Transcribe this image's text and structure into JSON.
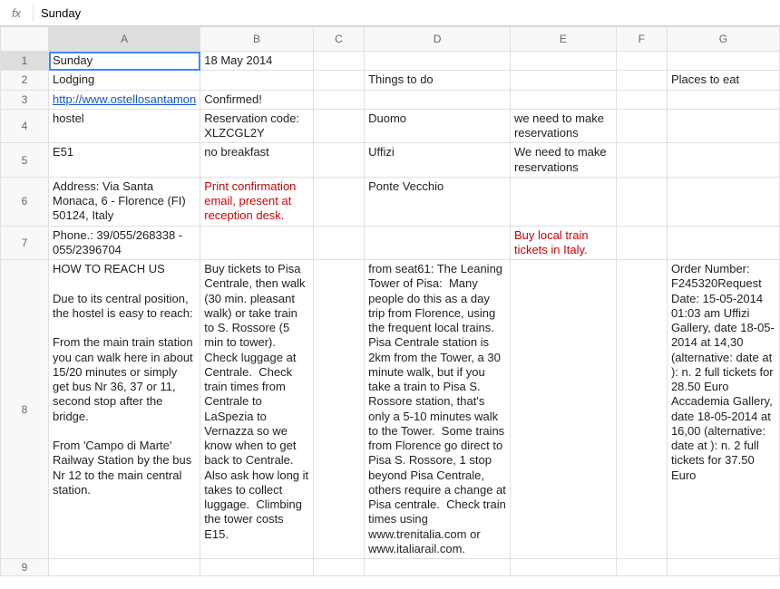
{
  "formula_bar": {
    "fx_label": "fx",
    "value": "Sunday"
  },
  "columns": [
    {
      "id": "A",
      "label": "A",
      "cls": "col-A"
    },
    {
      "id": "B",
      "label": "B",
      "cls": "col-B"
    },
    {
      "id": "C",
      "label": "C",
      "cls": "col-C"
    },
    {
      "id": "D",
      "label": "D",
      "cls": "col-D"
    },
    {
      "id": "E",
      "label": "E",
      "cls": "col-E"
    },
    {
      "id": "F",
      "label": "F",
      "cls": "col-F"
    },
    {
      "id": "G",
      "label": "G",
      "cls": "col-G"
    }
  ],
  "active_cell": "A1",
  "rows": [
    {
      "n": 1,
      "cells": {
        "A": {
          "text": "Sunday",
          "active": true
        },
        "B": {
          "text": "18 May 2014"
        }
      }
    },
    {
      "n": 2,
      "cells": {
        "A": {
          "text": "Lodging"
        },
        "D": {
          "text": "Things to do"
        },
        "G": {
          "text": "Places to eat"
        }
      }
    },
    {
      "n": 3,
      "cells": {
        "A": {
          "text": "http://www.ostellosantamon",
          "link": true
        },
        "B": {
          "text": "Confirmed!"
        }
      }
    },
    {
      "n": 4,
      "cells": {
        "A": {
          "text": "hostel"
        },
        "B": {
          "text": "Reservation code: XLZCGL2Y"
        },
        "D": {
          "text": "Duomo"
        },
        "E": {
          "text": "we need to make reservations"
        }
      }
    },
    {
      "n": 5,
      "cells": {
        "A": {
          "text": "E51"
        },
        "B": {
          "text": "no breakfast"
        },
        "D": {
          "text": "Uffizi"
        },
        "E": {
          "text": "We need to make reservations"
        }
      }
    },
    {
      "n": 6,
      "cells": {
        "A": {
          "text": "Address: Via Santa Monaca, 6 - Florence (FI) 50124, Italy"
        },
        "B": {
          "text": "Print confirmation email, present at reception desk.",
          "cls": "red-text"
        },
        "D": {
          "text": "Ponte Vecchio"
        }
      }
    },
    {
      "n": 7,
      "cells": {
        "A": {
          "text": "Phone.: 39/055/268338 - 055/2396704"
        },
        "E": {
          "text": "Buy local train tickets in Italy.",
          "cls": "red-text"
        }
      }
    },
    {
      "n": 8,
      "cells": {
        "A": {
          "text": "HOW TO REACH US\n\nDue to its central position, the hostel is easy to reach:\n\nFrom the main train station you can walk here in about 15/20 minutes or simply\nget bus Nr 36, 37 or 11, second stop after the bridge.\n\nFrom 'Campo di Marte' Railway Station by the bus Nr 12 to the main central\nstation."
        },
        "B": {
          "text": "Buy tickets to Pisa Centrale, then walk (30 min. pleasant walk) or take train to S. Rossore (5 min to tower).  Check luggage at Centrale.  Check train times from Centrale to LaSpezia to Vernazza so we know when to get back to Centrale.  Also ask how long it takes to collect luggage.  Climbing the tower costs E15."
        },
        "D": {
          "text": "from seat61: The Leaning Tower of Pisa:  Many people do this as a day trip from Florence, using the frequent local trains.  Pisa Centrale station is 2km from the Tower, a 30 minute walk, but if you take a train to Pisa S. Rossore station, that's only a 5-10 minutes walk to the Tower.  Some trains from Florence go direct to Pisa S. Rossore, 1 stop beyond Pisa Centrale, others require a change at Pisa centrale.  Check train times using www.trenitalia.com or www.italiarail.com."
        },
        "G": {
          "text": "Order Number: F245320Request Date: 15-05-2014 01:03 am Uffizi Gallery, date 18-05-2014 at 14,30 (alternative: date at ): n. 2 full tickets for 28.50 Euro Accademia Gallery, date 18-05-2014 at 16,00 (alternative: date at ): n. 2 full tickets for 37.50 Euro"
        }
      }
    },
    {
      "n": 9,
      "cells": {}
    }
  ]
}
